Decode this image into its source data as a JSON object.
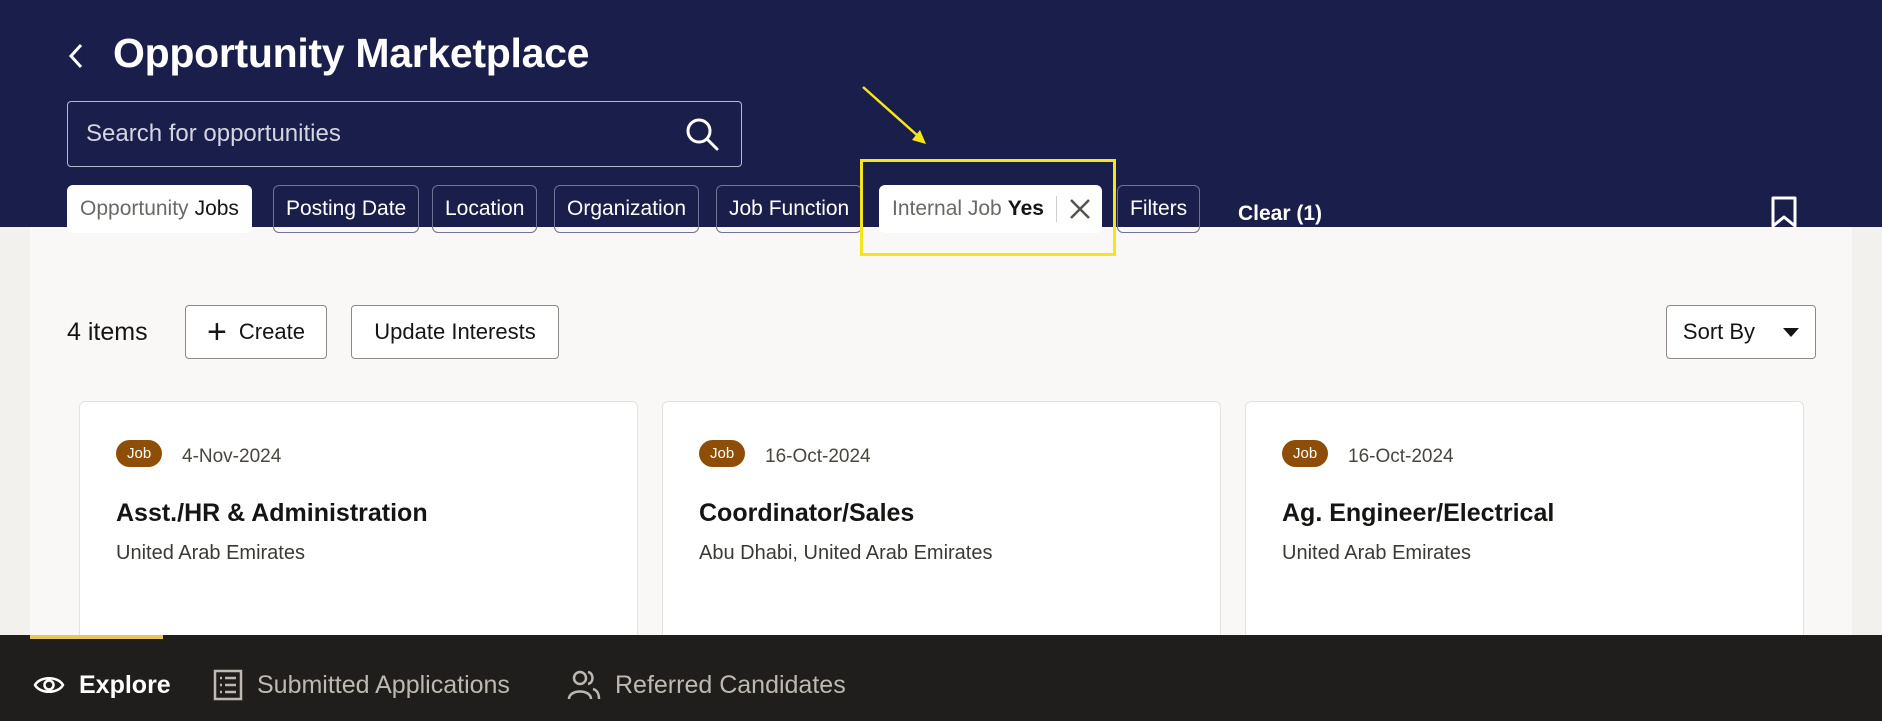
{
  "header": {
    "title": "Opportunity Marketplace",
    "search_placeholder": "Search for opportunities"
  },
  "filters": {
    "chips": [
      {
        "prefix": "Opportunity",
        "value": "Jobs"
      },
      {
        "label": "Posting Date"
      },
      {
        "label": "Location"
      },
      {
        "label": "Organization"
      },
      {
        "label": "Job Function"
      },
      {
        "prefix": "Internal Job",
        "value": "Yes"
      },
      {
        "label": "Filters"
      }
    ],
    "clear_label": "Clear (1)"
  },
  "toolbar": {
    "items_count": "4 items",
    "create_label": "Create",
    "update_interests_label": "Update Interests",
    "sort_label": "Sort By"
  },
  "cards": [
    {
      "badge": "Job",
      "date": "4-Nov-2024",
      "title": "Asst./HR & Administration",
      "location": "United Arab Emirates"
    },
    {
      "badge": "Job",
      "date": "16-Oct-2024",
      "title": "Coordinator/Sales",
      "location": "Abu Dhabi, United Arab Emirates"
    },
    {
      "badge": "Job",
      "date": "16-Oct-2024",
      "title": "Ag. Engineer/Electrical",
      "location": "United Arab Emirates"
    }
  ],
  "bottom_nav": [
    {
      "label": "Explore",
      "icon": "eye-icon",
      "active": true
    },
    {
      "label": "Submitted Applications",
      "icon": "list-icon",
      "active": false
    },
    {
      "label": "Referred Candidates",
      "icon": "people-icon",
      "active": false
    }
  ],
  "colors": {
    "header_bg": "#1a1e4b",
    "highlight": "#f7e51c",
    "badge": "#8e4e07",
    "bottom_bar": "#201e1c",
    "active_indicator": "#e8c55a"
  }
}
